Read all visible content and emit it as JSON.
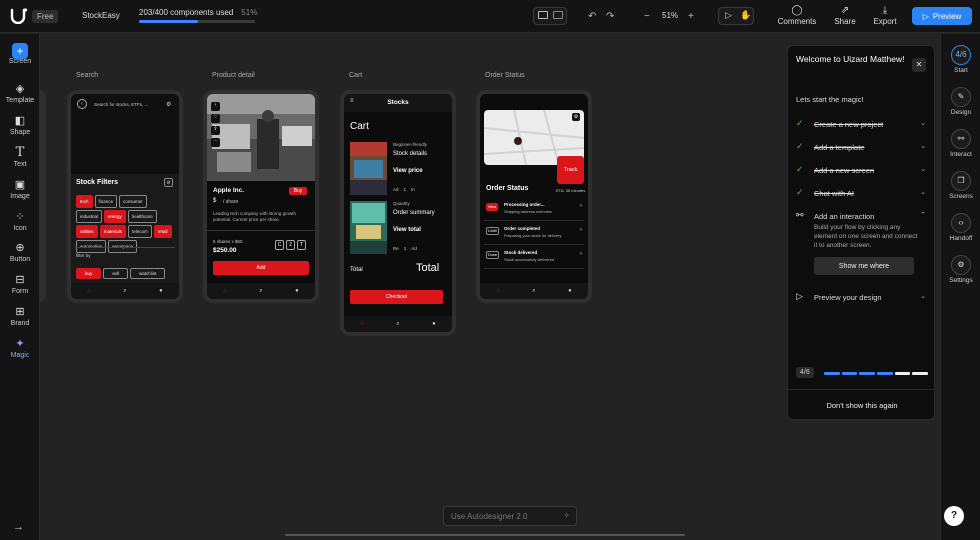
{
  "topbar": {
    "plan": "Free",
    "project": "StockEasy",
    "usage_text": "203/400 components used",
    "usage_pct": "51%",
    "usage_fraction": 0.51,
    "zoom_minus": "−",
    "zoom": "51%",
    "zoom_plus": "+",
    "comments": "Comments",
    "share": "Share",
    "export": "Export",
    "preview": "Preview"
  },
  "tools": {
    "screen": "Screen",
    "template": "Template",
    "shape": "Shape",
    "text": "Text",
    "image": "Image",
    "icon": "Icon",
    "button": "Button",
    "form": "Form",
    "brand": "Brand",
    "magic": "Magic"
  },
  "screens": {
    "search": {
      "label": "Search",
      "placeholder": "Search for stocks, ETFs, ...",
      "filters_title": "Stock Filters",
      "chips": [
        "tech",
        "finance",
        "consumer",
        "industrial",
        "energy",
        "healthcare",
        "utilities",
        "materials",
        "telecom",
        "retail",
        "automotive",
        "aerospace"
      ],
      "filter_by": "filter by",
      "filter_chips": [
        "buy",
        "sell",
        "watchlist"
      ]
    },
    "product": {
      "label": "Product detail",
      "name": "Apple Inc.",
      "buy": "Buy",
      "price_prefix": "$",
      "per_share": "/ share",
      "description": "Leading tech company with strong growth potential. Current price per share.",
      "shares_text": "5 shares x $50",
      "total": "$250.00",
      "stepper": [
        "C",
        "2",
        "T"
      ],
      "add": "Add"
    },
    "cart": {
      "label": "Cart",
      "header": "Stocks",
      "title": "Cart",
      "item1_tag": "Beginner-friendly",
      "item1_title": "Stock details",
      "item1_price": "View price",
      "item1_meta": [
        "Ad",
        "1",
        "In"
      ],
      "item2_tag": "Quantity",
      "item2_title": "Order summary",
      "item2_total": "View total",
      "item2_meta": [
        "Re",
        "1",
        "Ad"
      ],
      "total_label": "Total",
      "total_big": "Total",
      "checkout": "Checkout"
    },
    "order": {
      "label": "Order Status",
      "track": "Track",
      "title": "Order Status",
      "eta": "ETA: 35 minutes",
      "rows": [
        {
          "badge": "View",
          "title": "Processing order...",
          "sub": "Shipping address overview"
        },
        {
          "badge": "Untitl",
          "title": "Order completed",
          "sub": "Preparing your stock for delivery"
        },
        {
          "badge": "Done",
          "title": "Stock delivered",
          "sub": "Stock successfully delivered"
        }
      ]
    }
  },
  "panel": {
    "title": "Welcome to Uizard Matthew!",
    "subtitle": "Lets start the magic!",
    "steps": [
      {
        "label": "Create a new project"
      },
      {
        "label": "Add a template"
      },
      {
        "label": "Add a new screen"
      },
      {
        "label": "Chat with AI"
      },
      {
        "label": "Add an interaction"
      },
      {
        "label": "Preview your design"
      }
    ],
    "interaction_desc": "Build your flow by clicking any element on one screen and connect it to another screen.",
    "show_me": "Show me where",
    "counter": "4/6",
    "progress_done": 4,
    "progress_total": 6,
    "dont_show": "Don't show this again"
  },
  "rightrail": {
    "start_badge": "4/6",
    "start": "Start",
    "design": "Design",
    "interact": "Interact",
    "screens": "Screens",
    "handoff": "Handoff",
    "settings": "Settings"
  },
  "autodesigner": "Use Autodesigner 2.0",
  "help": "?"
}
